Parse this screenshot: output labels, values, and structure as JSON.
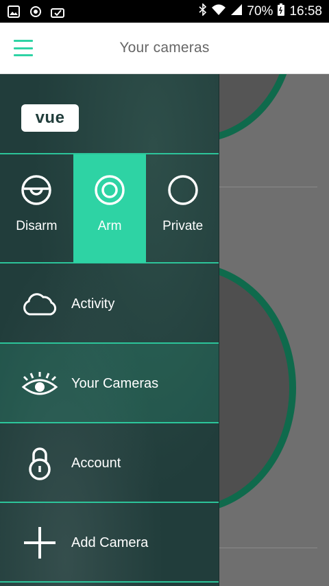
{
  "status_bar": {
    "battery": "70%",
    "time": "16:58"
  },
  "app_bar": {
    "title": "Your cameras"
  },
  "drawer": {
    "logo_text": "vue",
    "modes": [
      {
        "label": "Disarm",
        "active": false
      },
      {
        "label": "Arm",
        "active": true
      },
      {
        "label": "Private",
        "active": false
      }
    ],
    "nav": [
      {
        "label": "Activity",
        "icon": "cloud-icon",
        "active": false
      },
      {
        "label": "Your Cameras",
        "icon": "eye-icon",
        "active": true
      },
      {
        "label": "Account",
        "icon": "lock-icon",
        "active": false
      },
      {
        "label": "Add Camera",
        "icon": "plus-icon",
        "active": false
      }
    ]
  },
  "colors": {
    "accent": "#2ed3a4",
    "drawer_bg": "#213d3b",
    "camera_ring": "#0f6a4c"
  }
}
